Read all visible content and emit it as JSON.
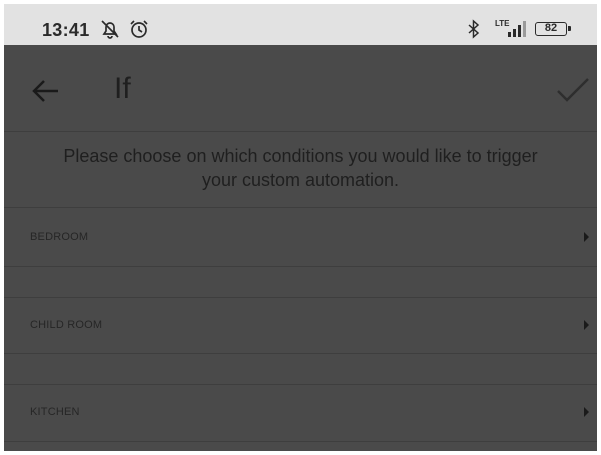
{
  "status_bar": {
    "time": "13:41",
    "icons": [
      "bell-off-icon",
      "alarm-icon",
      "bluetooth-icon",
      "lte-signal-icon"
    ],
    "network_label": "LTE",
    "battery": "82"
  },
  "app_bar": {
    "title": "If",
    "back_icon": "arrow-left-icon",
    "confirm_icon": "check-icon"
  },
  "instruction": {
    "line1": "Please choose on which conditions you would like to trigger",
    "line2": "your custom automation."
  },
  "rooms": [
    {
      "label": "BEDROOM"
    },
    {
      "label": "CHILD ROOM"
    },
    {
      "label": "KITCHEN"
    }
  ],
  "colors": {
    "overlay_background": "#4a4a4a",
    "status_bar_background": "#e2e2e2",
    "text_dark": "#1f1f1f"
  }
}
